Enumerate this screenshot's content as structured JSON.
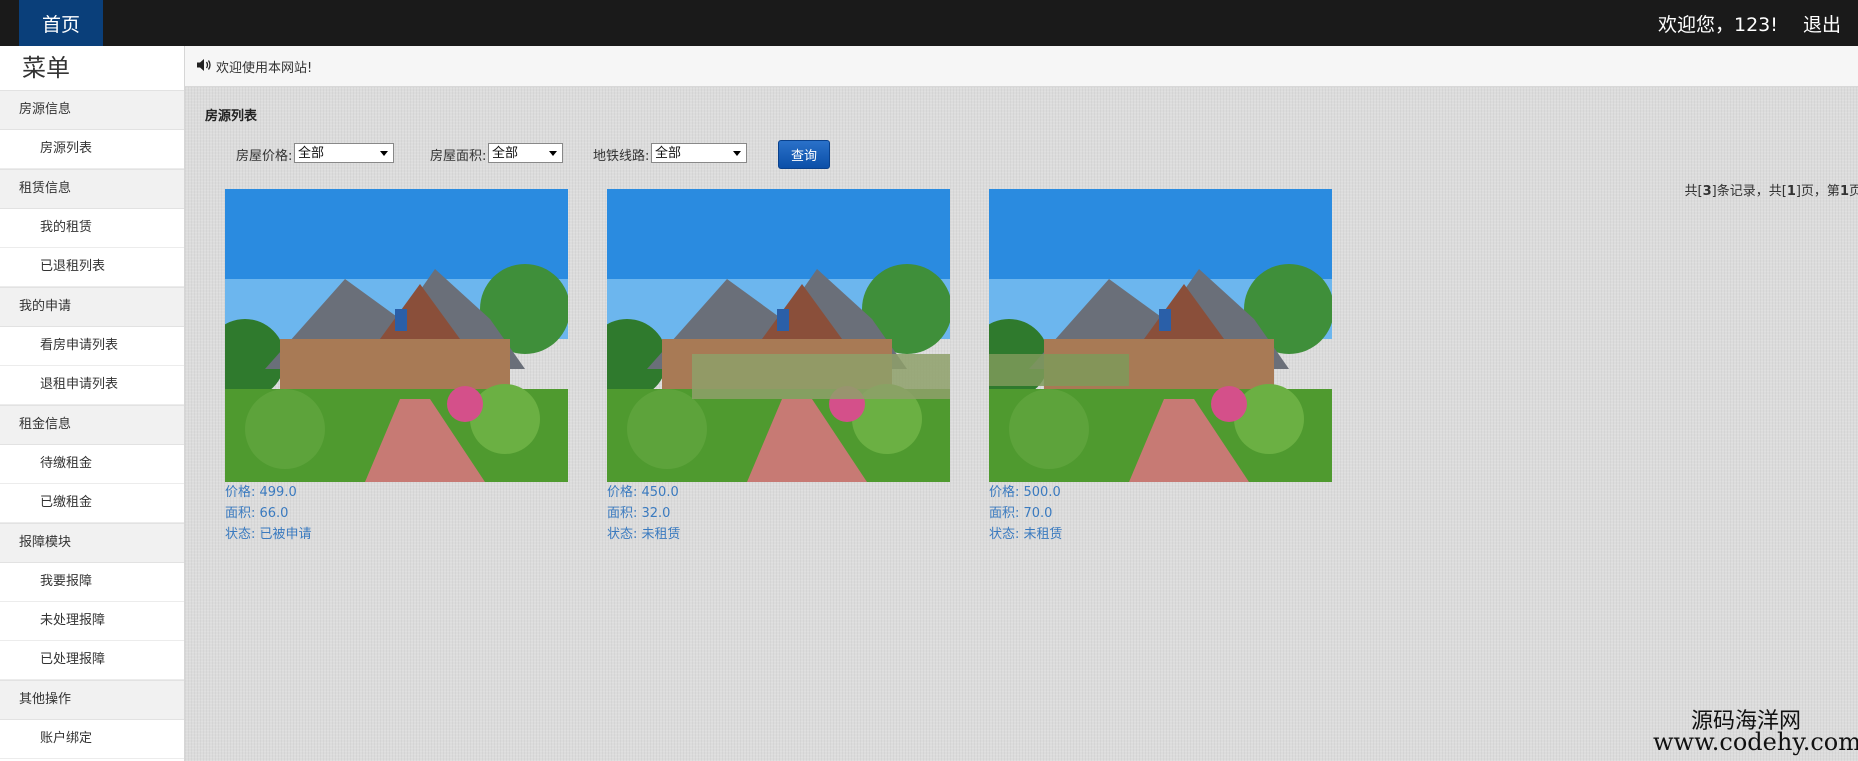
{
  "header": {
    "home_label": "首页",
    "welcome": "欢迎您，123!",
    "logout_label": "退出"
  },
  "sidebar": {
    "title": "菜单",
    "groups": [
      {
        "label": "房源信息",
        "items": [
          "房源列表"
        ]
      },
      {
        "label": "租赁信息",
        "items": [
          "我的租赁",
          "已退租列表"
        ]
      },
      {
        "label": "我的申请",
        "items": [
          "看房申请列表",
          "退租申请列表"
        ]
      },
      {
        "label": "租金信息",
        "items": [
          "待缴租金",
          "已缴租金"
        ]
      },
      {
        "label": "报障模块",
        "items": [
          "我要报障",
          "未处理报障",
          "已处理报障"
        ]
      },
      {
        "label": "其他操作",
        "items": [
          "账户绑定"
        ]
      }
    ]
  },
  "notice": {
    "text": "欢迎使用本网站!"
  },
  "main": {
    "title": "房源列表",
    "filters": [
      {
        "label": "房屋价格:",
        "value": "全部"
      },
      {
        "label": "房屋面积:",
        "value": "全部"
      },
      {
        "label": "地铁线路:",
        "value": "全部"
      }
    ],
    "query_label": "查询",
    "pager": {
      "prefix": "共[",
      "total": "3",
      "mid": "]条记录，共[",
      "pages": "1",
      "mid2": "]页，第",
      "current": "1",
      "suffix": "页"
    },
    "houses": [
      {
        "price": "价格: 499.0",
        "area": "面积: 66.0",
        "status": "状态: 已被申请"
      },
      {
        "price": "价格: 450.0",
        "area": "面积: 32.0",
        "status": "状态: 未租赁"
      },
      {
        "price": "价格: 500.0",
        "area": "面积: 70.0",
        "status": "状态: 未租赁"
      }
    ]
  },
  "watermark": {
    "line1": "源码海洋网",
    "line2": "www.codehy.com"
  },
  "colors": {
    "topbar": "#1a1a1a",
    "home_tab": "#0a3f7a",
    "info_text": "#3a7abf",
    "query_button": "#0b4fa8"
  }
}
